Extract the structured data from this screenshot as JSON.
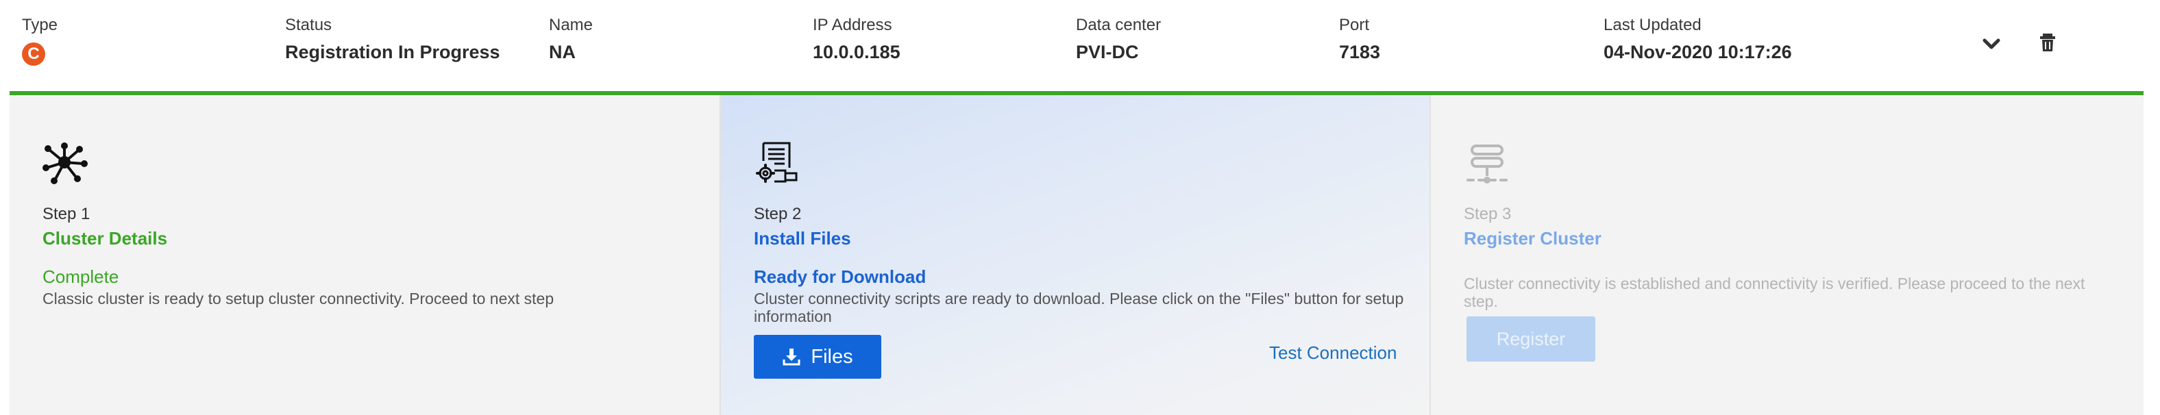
{
  "header": {
    "type": {
      "label": "Type",
      "icon": "cluster-type-icon",
      "icon_letter": "C",
      "icon_color": "#e9581f"
    },
    "status": {
      "label": "Status",
      "value": "Registration In Progress"
    },
    "name": {
      "label": "Name",
      "value": "NA"
    },
    "ip": {
      "label": "IP Address",
      "value": "10.0.0.185"
    },
    "datacenter": {
      "label": "Data center",
      "value": "PVI-DC"
    },
    "port": {
      "label": "Port",
      "value": "7183"
    },
    "updated": {
      "label": "Last Updated",
      "value": "04-Nov-2020 10:17:26"
    },
    "actions": [
      "chevron-down-icon",
      "trash-icon"
    ]
  },
  "progress_color": "#3aa626",
  "steps": {
    "s1": {
      "icon": "hub-network-icon",
      "number": "Step 1",
      "title": "Cluster Details",
      "status": "Complete",
      "description": "Classic cluster is ready to setup cluster connectivity. Proceed to next step"
    },
    "s2": {
      "icon": "install-files-icon",
      "number": "Step 2",
      "title": "Install Files",
      "status": "Ready for Download",
      "description": "Cluster connectivity scripts are ready to download. Please click on the \"Files\" button for setup information",
      "files_button": "Files",
      "test_link": "Test Connection"
    },
    "s3": {
      "icon": "server-stack-icon",
      "number": "Step 3",
      "title": "Register Cluster",
      "description": "Cluster connectivity is established and connectivity is verified. Please proceed to the next step.",
      "register_button": "Register"
    }
  },
  "colors": {
    "complete": "#3aa626",
    "active": "#1a63d1",
    "primary_button": "#1265d8",
    "disabled_button": "#b8d2f3"
  }
}
